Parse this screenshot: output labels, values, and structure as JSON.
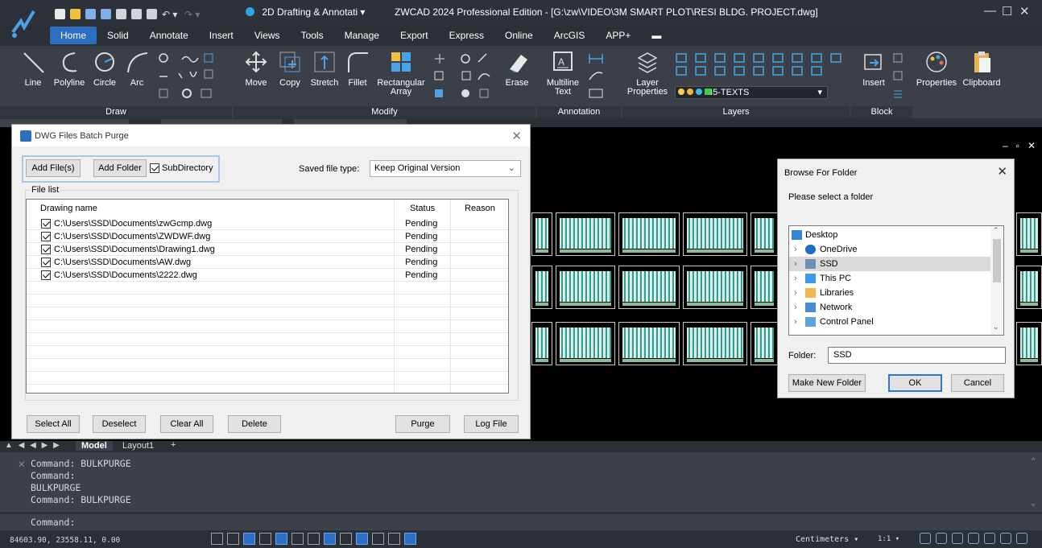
{
  "window": {
    "workspace": "2D Drafting & Annotati",
    "title": "ZWCAD 2024 Professional Edition - [G:\\zw\\VIDEO\\3M SMART PLOT\\RESI BLDG. PROJECT.dwg]"
  },
  "ribbon": {
    "tabs": [
      "Home",
      "Solid",
      "Annotate",
      "Insert",
      "Views",
      "Tools",
      "Manage",
      "Export",
      "Express",
      "Online",
      "ArcGIS",
      "APP+"
    ],
    "groups": [
      "Draw",
      "Modify",
      "Annotation",
      "Layers",
      "Block"
    ],
    "draw_buttons": [
      "Line",
      "Polyline",
      "Circle",
      "Arc"
    ],
    "modify_buttons": [
      "Move",
      "Copy",
      "Stretch",
      "Fillet",
      "Rectangular",
      "Array",
      "Erase"
    ],
    "annotation_buttons": [
      "Multiline",
      "Text"
    ],
    "layer_button_line1": "Layer",
    "layer_button_line2": "Properties",
    "current_layer": "45-TEXTS",
    "block_buttons": [
      "Insert",
      "Properties",
      "Clipboard"
    ]
  },
  "purge_dialog": {
    "title": "DWG Files Batch Purge",
    "add_files": "Add File(s)",
    "add_folder": "Add Folder",
    "subdirectory": "SubDirectory",
    "subdirectory_checked": true,
    "saved_type_label": "Saved file type:",
    "saved_type_value": "Keep Original Version",
    "file_list_label": "File list",
    "columns": [
      "Drawing name",
      "Status",
      "Reason"
    ],
    "files": [
      {
        "name": "C:\\Users\\SSD\\Documents\\zwGcmp.dwg",
        "status": "Pending",
        "checked": true
      },
      {
        "name": "C:\\Users\\SSD\\Documents\\ZWDWF.dwg",
        "status": "Pending",
        "checked": true
      },
      {
        "name": "C:\\Users\\SSD\\Documents\\Drawing1.dwg",
        "status": "Pending",
        "checked": true
      },
      {
        "name": "C:\\Users\\SSD\\Documents\\AW.dwg",
        "status": "Pending",
        "checked": true
      },
      {
        "name": "C:\\Users\\SSD\\Documents\\2222.dwg",
        "status": "Pending",
        "checked": true
      }
    ],
    "buttons": {
      "select_all": "Select All",
      "deselect": "Deselect",
      "clear_all": "Clear All",
      "delete": "Delete",
      "purge": "Purge",
      "log_file": "Log File"
    }
  },
  "browse_dialog": {
    "title": "Browse For Folder",
    "prompt": "Please select a folder",
    "tree": [
      "Desktop",
      "OneDrive",
      "SSD",
      "This PC",
      "Libraries",
      "Network",
      "Control Panel"
    ],
    "folder_label": "Folder:",
    "folder_value": "SSD",
    "make_new_folder": "Make New Folder",
    "ok": "OK",
    "cancel": "Cancel"
  },
  "layout_tabs": {
    "model": "Model",
    "layout1": "Layout1",
    "add": "+"
  },
  "command_history": [
    "Command: BULKPURGE",
    "Command:",
    "BULKPURGE",
    "Command: BULKPURGE"
  ],
  "command_prompt": "Command:",
  "status": {
    "coords": "84603.90, 23558.11, 0.00",
    "units": "Centimeters",
    "scale": "1:1"
  },
  "colors": {
    "accent": "#2b6ec2",
    "canvas": "#000000",
    "ribbon": "#3a3f48"
  }
}
